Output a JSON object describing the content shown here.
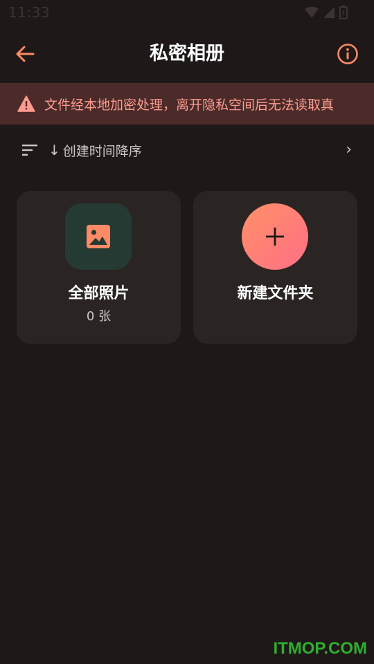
{
  "status_bar": {
    "time": "11:33"
  },
  "app_bar": {
    "title": "私密相册",
    "back_icon": "arrow-left-icon",
    "info_icon": "info-icon"
  },
  "warning": {
    "icon": "warning-triangle-icon",
    "text": "文件经本地加密处理，离开隐私空间后无法读取真"
  },
  "sort": {
    "icon": "sort-lines-icon",
    "arrow": "↓",
    "label": "创建时间降序",
    "chevron": "›"
  },
  "cards": [
    {
      "title": "全部照片",
      "count": "0 张",
      "icon": "image-icon"
    },
    {
      "title": "新建文件夹",
      "icon": "plus-icon"
    }
  ],
  "watermark": "ITMOP.COM",
  "colors": {
    "background": "#1e1918",
    "accent": "#ff8a65",
    "warning_bg": "#4a2b29",
    "warning_text": "#ff9a8f",
    "card_bg": "#2a2423",
    "thumb_green": "#253a33"
  }
}
